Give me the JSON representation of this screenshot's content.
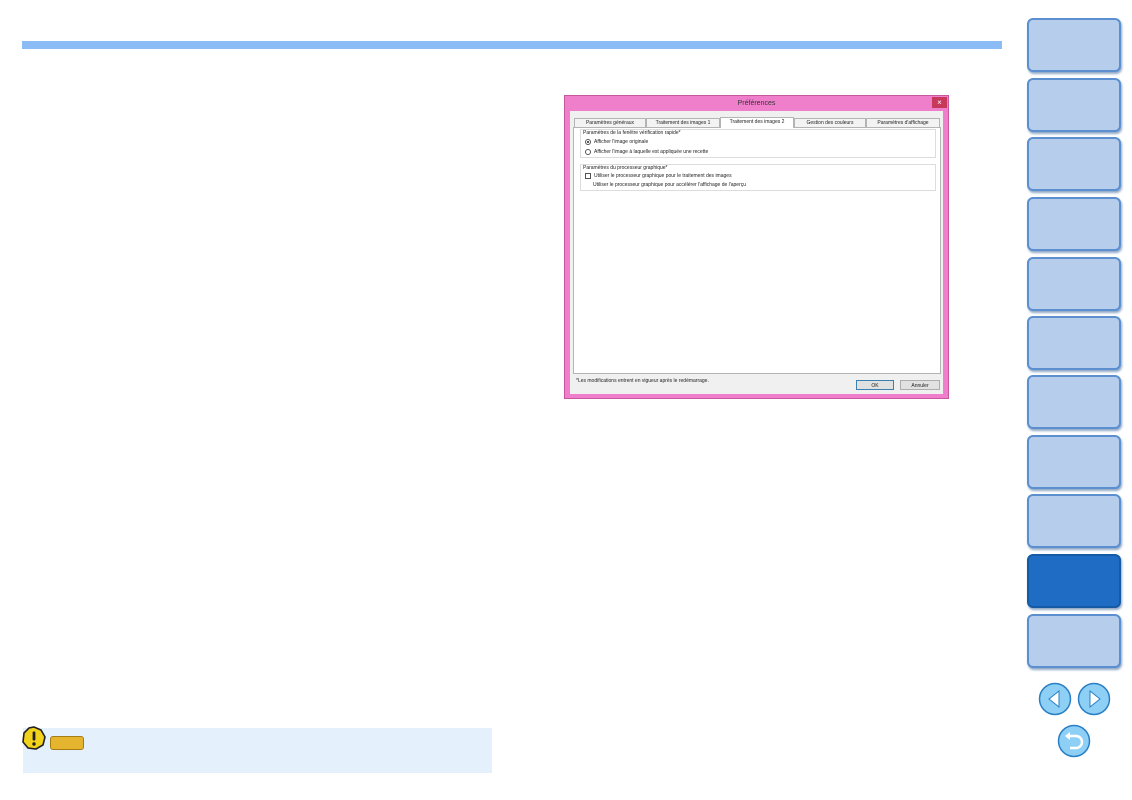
{
  "dialog": {
    "title": "Préférences",
    "close_label": "×",
    "tabs": [
      {
        "label": "Paramètres généraux"
      },
      {
        "label": "Traitement des images 1"
      },
      {
        "label": "Traitement des images 2"
      },
      {
        "label": "Gestion des couleurs"
      },
      {
        "label": "Paramètres d'affichage"
      }
    ],
    "active_tab": 2,
    "quick_check_group": {
      "title": "Paramètres de la fenêtre vérification rapide*",
      "options": [
        {
          "label": "Afficher l'image originale",
          "selected": true
        },
        {
          "label": "Afficher l'image à laquelle est appliquée une recette",
          "selected": false
        }
      ]
    },
    "gpu_group": {
      "title": "Paramètres du processeur graphique*",
      "checkbox_label": "Utiliser le processeur graphique pour le traitement des images",
      "checkbox_checked": false,
      "sub_label": "Utiliser le processeur graphique pour accélérer l'affichage de l'aperçu"
    },
    "footnote": "*Les modifications entrent en vigueur après le redémarrage.",
    "ok_label": "OK",
    "cancel_label": "Annuler"
  },
  "nav": {
    "button_count": 11,
    "current_index": 9
  },
  "colors": {
    "top_bar": "#8cbcf5",
    "dialog_frame": "#f07fcb",
    "nav_button": "#b6cdeb",
    "nav_button_current": "#1e6cc3",
    "warning_bg": "#e4f0fc",
    "warning_badge": "#e6b530"
  },
  "icons": {
    "warning": "warning-icon",
    "prev": "arrow-left-icon",
    "next": "arrow-right-icon",
    "back": "return-icon"
  }
}
